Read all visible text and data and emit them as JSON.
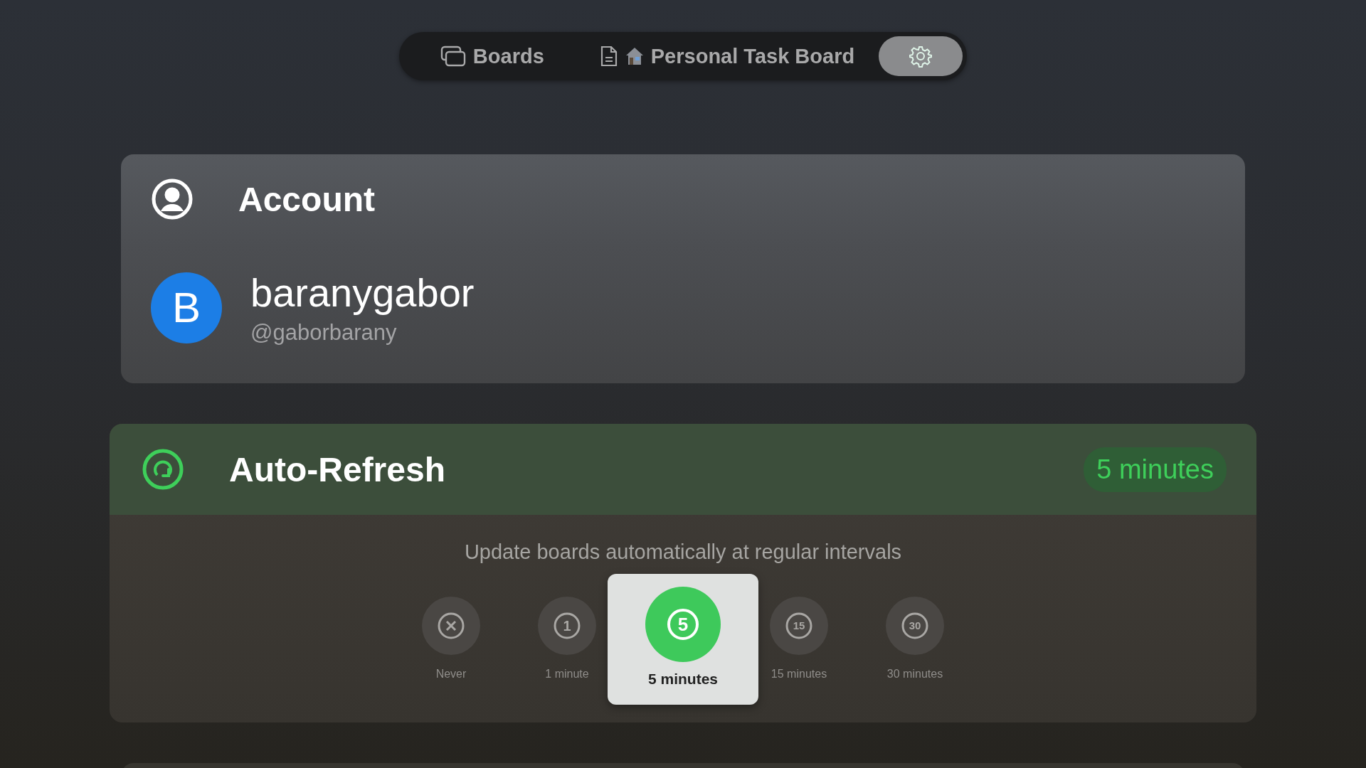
{
  "nav": [
    {
      "kind": "boards",
      "label": "Boards",
      "selected": false
    },
    {
      "kind": "board",
      "label": "Personal Task Board",
      "selected": false
    },
    {
      "kind": "settings",
      "selected": true
    }
  ],
  "account": {
    "title": "Account",
    "avatar_letter": "B",
    "name": "baranygabor",
    "handle": "@gaborbarany"
  },
  "auto_refresh": {
    "title": "Auto-Refresh",
    "badge": "5 minutes",
    "description": "Update boards automatically at regular intervals",
    "options": [
      {
        "kind": "never",
        "label": "Never",
        "selected": false
      },
      {
        "kind": "number",
        "glyph": "1",
        "label": "1 minute",
        "selected": false
      },
      {
        "kind": "number",
        "glyph": "5",
        "label": "5 minutes",
        "selected": true
      },
      {
        "kind": "number",
        "glyph": "15",
        "label": "15 minutes",
        "selected": false
      },
      {
        "kind": "number",
        "glyph": "30",
        "label": "30 minutes",
        "selected": false
      }
    ]
  }
}
